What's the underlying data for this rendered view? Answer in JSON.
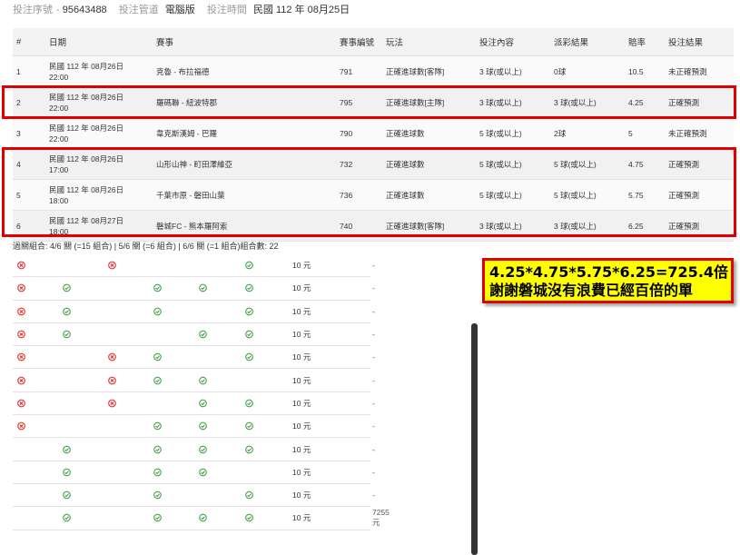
{
  "header": {
    "serial_label": "投注序號",
    "serial_value": "95643488",
    "channel_label": "投注管道",
    "channel_value": "電腦版",
    "time_label": "投注時間",
    "time_value": "民國 112 年 08月25日"
  },
  "columns": [
    "#",
    "日期",
    "賽事",
    "賽事編號",
    "玩法",
    "投注內容",
    "派彩結果",
    "賠率",
    "投注結果"
  ],
  "rows": [
    {
      "no": "1",
      "date": "民國 112 年 08月26日",
      "time": "22:00",
      "match": "克魯 - 布拉福德",
      "code": "791",
      "play": "正確進球數[客隊]",
      "pick": "3 球(或以上)",
      "result": "0球",
      "odds": "10.5",
      "outcome": "未正確預測"
    },
    {
      "no": "2",
      "date": "民國 112 年 08月26日",
      "time": "22:00",
      "match": "羅碼聯 - 紐波特郡",
      "code": "795",
      "play": "正確進球數[主隊]",
      "pick": "3 球(或以上)",
      "result": "3 球(或以上)",
      "odds": "4.25",
      "outcome": "正確預測"
    },
    {
      "no": "3",
      "date": "民國 112 年 08月26日",
      "time": "22:00",
      "match": "韋克斯漢姆 - 巴羅",
      "code": "790",
      "play": "正確進球數",
      "pick": "5 球(或以上)",
      "result": "2球",
      "odds": "5",
      "outcome": "未正確預測"
    },
    {
      "no": "4",
      "date": "民國 112 年 08月26日",
      "time": "17:00",
      "match": "山形山神 - 町田澤維亞",
      "code": "732",
      "play": "正確進球數",
      "pick": "5 球(或以上)",
      "result": "5 球(或以上)",
      "odds": "4.75",
      "outcome": "正確預測"
    },
    {
      "no": "5",
      "date": "民國 112 年 08月26日",
      "time": "18:00",
      "match": "千葉市原 - 磐田山葉",
      "code": "736",
      "play": "正確進球數",
      "pick": "5 球(或以上)",
      "result": "5 球(或以上)",
      "odds": "5.75",
      "outcome": "正確預測"
    },
    {
      "no": "6",
      "date": "民國 112 年 08月27日",
      "time": "18:00",
      "match": "磐城FC - 熊本羅阿索",
      "code": "740",
      "play": "正確進球數[客隊]",
      "pick": "3 球(或以上)",
      "result": "3 球(或以上)",
      "odds": "6.25",
      "outcome": "正確預測"
    }
  ],
  "combo_summary": "過關組合: 4/6 關 (=15 組合) | 5/6 關 (=6 組合) | 6/6 關 (=1 組合)組合數: 22",
  "combos": [
    {
      "icons": [
        "x",
        "",
        "x",
        "",
        "",
        "v"
      ],
      "amount": "10 元",
      "win": "-"
    },
    {
      "icons": [
        "x",
        "v",
        "",
        "v",
        "v",
        "v"
      ],
      "amount": "10 元",
      "win": "-"
    },
    {
      "icons": [
        "x",
        "v",
        "",
        "v",
        "",
        "v"
      ],
      "amount": "10 元",
      "win": "-"
    },
    {
      "icons": [
        "x",
        "v",
        "",
        "",
        "v",
        "v"
      ],
      "amount": "10 元",
      "win": "-"
    },
    {
      "icons": [
        "x",
        "",
        "x",
        "v",
        "",
        "v"
      ],
      "amount": "10 元",
      "win": "-"
    },
    {
      "icons": [
        "x",
        "",
        "x",
        "v",
        "v",
        ""
      ],
      "amount": "10 元",
      "win": "-"
    },
    {
      "icons": [
        "x",
        "",
        "x",
        "",
        "v",
        "v"
      ],
      "amount": "10 元",
      "win": "-"
    },
    {
      "icons": [
        "x",
        "",
        "",
        "v",
        "v",
        "v"
      ],
      "amount": "10 元",
      "win": "-"
    },
    {
      "icons": [
        "",
        "v",
        "",
        "v",
        "v",
        "v"
      ],
      "amount": "10 元",
      "win": "-"
    },
    {
      "icons": [
        "",
        "v",
        "",
        "v",
        "v",
        ""
      ],
      "amount": "10 元",
      "win": "-"
    },
    {
      "icons": [
        "",
        "v",
        "",
        "v",
        "",
        "v"
      ],
      "amount": "10 元",
      "win": "-"
    },
    {
      "icons": [
        "",
        "v",
        "",
        "v",
        "v",
        "v"
      ],
      "amount": "10 元",
      "win": "7255 元"
    }
  ],
  "callout": {
    "line1": "4.25*4.75*5.75*6.25=725.4倍",
    "line2": "謝謝磐城沒有浪費已經百倍的單"
  },
  "colors": {
    "loss": "#e53935",
    "win": "#43a047",
    "highlight": "#e00000",
    "callout_bg": "#ffff00"
  },
  "icon_names": {
    "x": "lose-x-circle-icon",
    "v": "win-check-circle-icon"
  }
}
